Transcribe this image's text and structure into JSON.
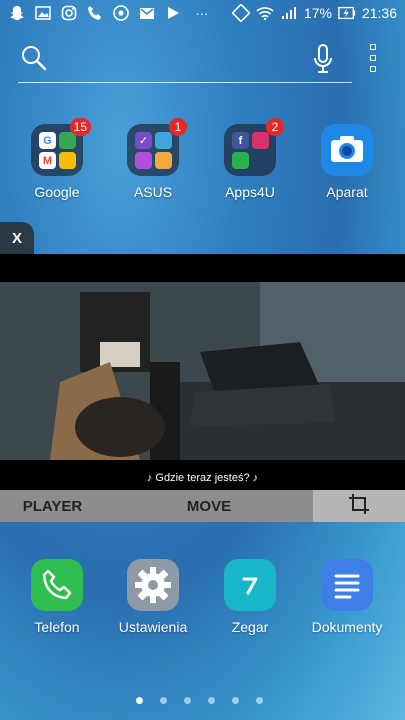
{
  "status_bar": {
    "battery": "17%",
    "time": "21:36",
    "overflow": "···"
  },
  "search": {
    "placeholder": ""
  },
  "top_apps": [
    {
      "label": "Google",
      "badge": "15"
    },
    {
      "label": "ASUS",
      "badge": "1"
    },
    {
      "label": "Apps4U",
      "badge": "2"
    },
    {
      "label": "Aparat",
      "badge": ""
    }
  ],
  "player": {
    "close_label": "X",
    "subtitle": "♪ Gdzie teraz jesteś? ♪",
    "player_label": "PLAYER",
    "move_label": "MOVE"
  },
  "dock_apps": [
    {
      "label": "Telefon"
    },
    {
      "label": "Ustawienia"
    },
    {
      "label": "Zegar"
    },
    {
      "label": "Dokumenty"
    }
  ],
  "page_indicator": {
    "count": 6,
    "active": 0
  }
}
